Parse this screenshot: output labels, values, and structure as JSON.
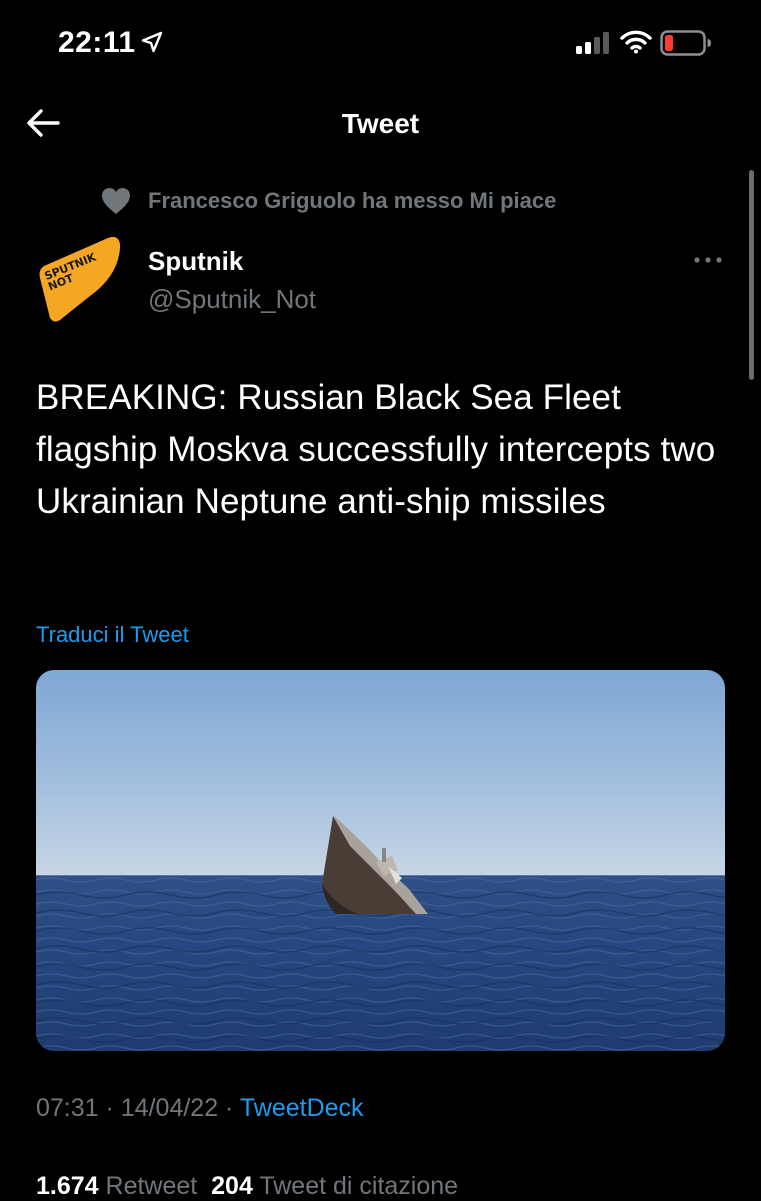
{
  "status_bar": {
    "time": "22:11",
    "icons": [
      "location-arrow-icon",
      "signal-icon",
      "wifi-icon",
      "battery-low-icon"
    ],
    "battery_color": "#ff3b30"
  },
  "nav": {
    "title": "Tweet",
    "back_icon": "back-arrow-icon"
  },
  "social_context": {
    "icon": "heart-icon",
    "text": "Francesco Griguolo ha messo Mi piace"
  },
  "author": {
    "name": "Sputnik",
    "handle": "@Sputnik_Not",
    "avatar_text_line1": "SPUTNIK",
    "avatar_text_line2": "NOT",
    "avatar_color": "#f5a623"
  },
  "tweet": {
    "text": "BREAKING: Russian Black Sea Fleet flagship Moskva successfully intercepts two Ukrainian Neptune anti-ship missiles",
    "translate_label": "Traduci il Tweet",
    "media_description_icon": "sinking-ship-image"
  },
  "meta": {
    "time": "07:31",
    "separator1": " · ",
    "date": "14/04/22",
    "separator2": " · ",
    "source": "TweetDeck"
  },
  "stats": {
    "retweets_count": "1.674",
    "retweets_label": "Retweet",
    "quotes_count": "204",
    "quotes_label": "Tweet di citazione"
  },
  "colors": {
    "background": "#000000",
    "link": "#1d9bf0",
    "secondary_text": "#71767b"
  }
}
